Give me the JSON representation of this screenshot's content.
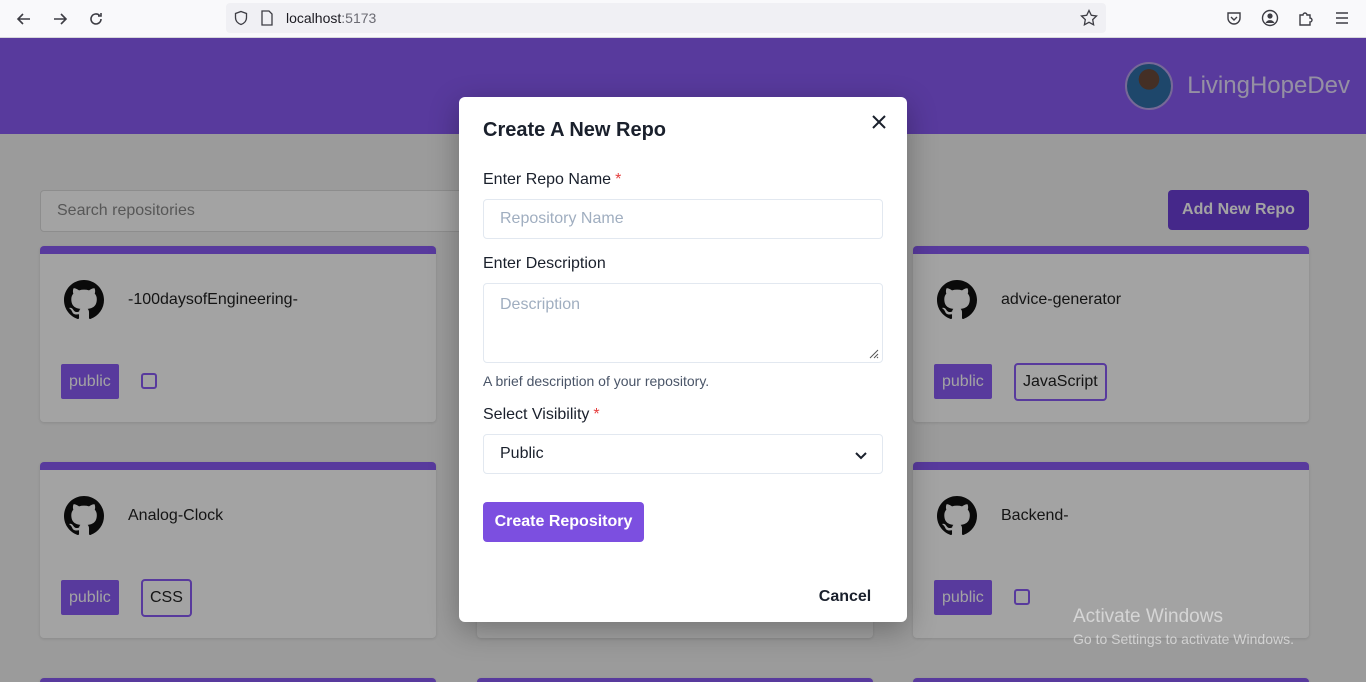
{
  "browser": {
    "url_host": "localhost",
    "url_port": ":5173"
  },
  "header": {
    "username": "LivingHopeDev"
  },
  "toolbar": {
    "search_placeholder": "Search repositories",
    "add_label": "Add New Repo"
  },
  "cards": [
    {
      "name": "-100daysofEngineering-",
      "visibility": "public",
      "language": ""
    },
    {
      "name": "advice-generator",
      "visibility": "public",
      "language": "JavaScript"
    },
    {
      "name": "Analog-Clock",
      "visibility": "public",
      "language": "CSS"
    },
    {
      "name": "Backend-",
      "visibility": "public",
      "language": ""
    }
  ],
  "modal": {
    "title": "Create A New Repo",
    "name_label": "Enter Repo Name",
    "required_mark": "*",
    "name_placeholder": "Repository Name",
    "desc_label": "Enter Description",
    "desc_placeholder": "Description",
    "desc_helper": "A brief description of your repository.",
    "visibility_label": "Select Visibility",
    "visibility_value": "Public",
    "create_label": "Create Repository",
    "cancel_label": "Cancel"
  },
  "watermark": {
    "title": "Activate Windows",
    "subtitle": "Go to Settings to activate Windows."
  },
  "colors": {
    "accent": "#8a5cf6",
    "button": "#7c4fe0",
    "required": "#e53e3e"
  }
}
